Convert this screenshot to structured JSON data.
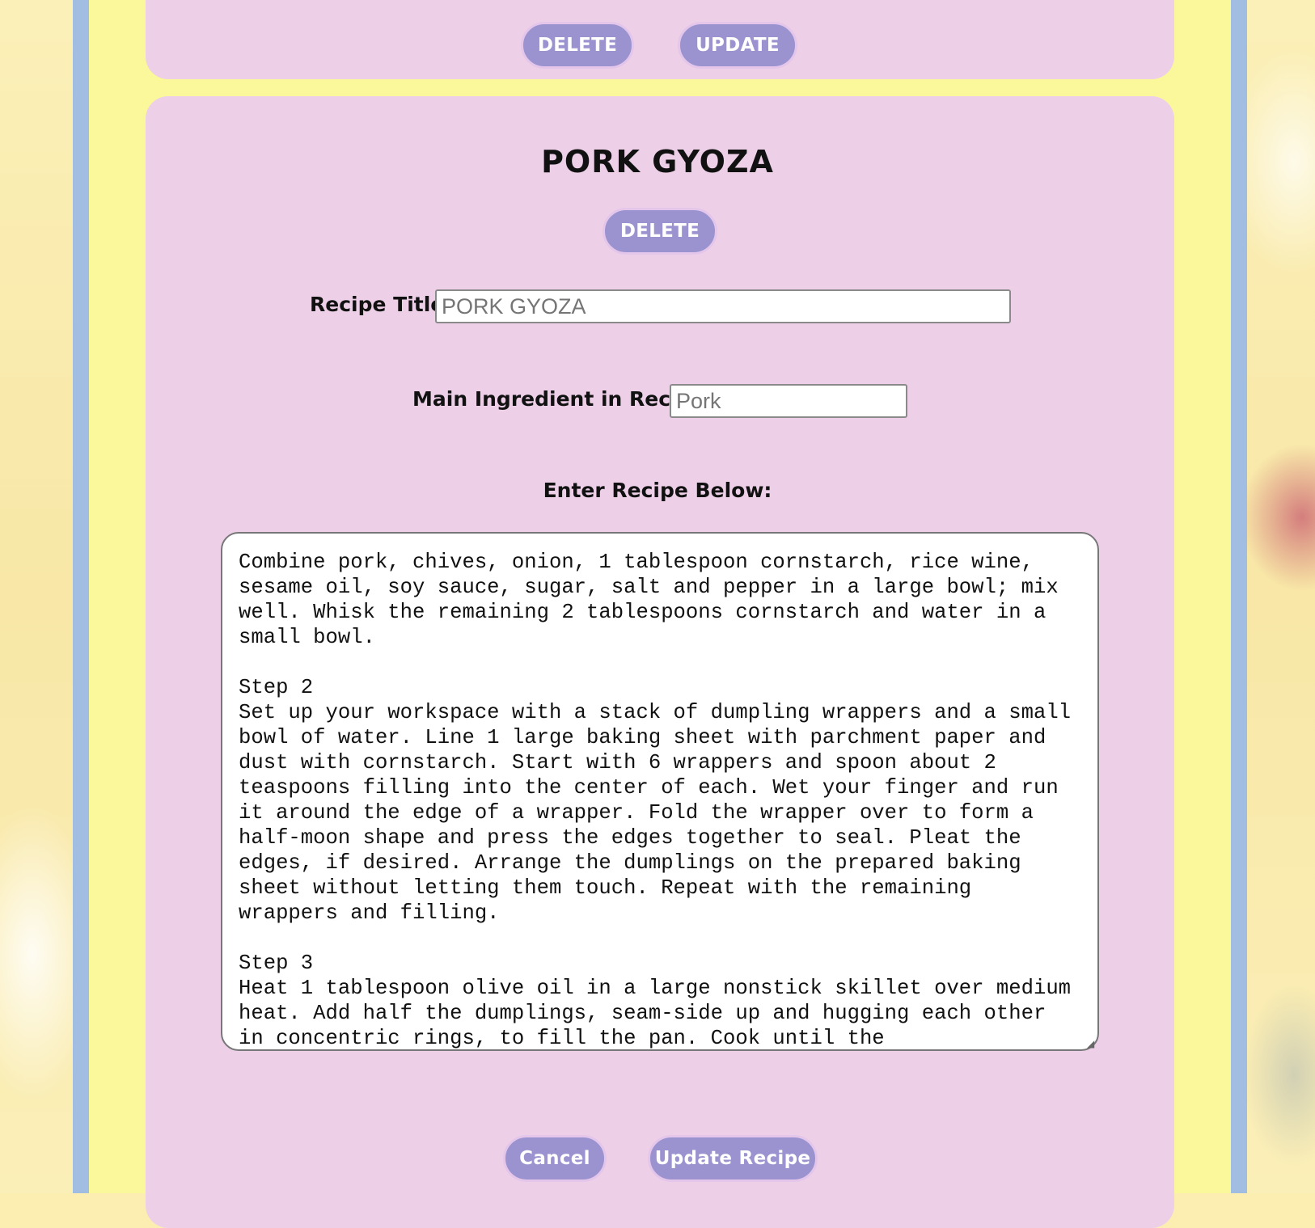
{
  "top_card": {
    "delete_label": "DELETE",
    "update_label": "UPDATE"
  },
  "recipe_card": {
    "title": "PORK GYOZA",
    "delete_label": "DELETE",
    "title_field": {
      "label": "Recipe Title:",
      "placeholder": "PORK GYOZA"
    },
    "ingredient_field": {
      "label": "Main Ingredient in Recipe:",
      "placeholder": "Pork"
    },
    "recipe_label": "Enter Recipe Below:",
    "recipe_text": "Combine pork, chives, onion, 1 tablespoon cornstarch, rice wine, sesame oil, soy sauce, sugar, salt and pepper in a large bowl; mix well. Whisk the remaining 2 tablespoons cornstarch and water in a small bowl.\n\nStep 2\nSet up your workspace with a stack of dumpling wrappers and a small bowl of water. Line 1 large baking sheet with parchment paper and dust with cornstarch. Start with 6 wrappers and spoon about 2 teaspoons filling into the center of each. Wet your finger and run it around the edge of a wrapper. Fold the wrapper over to form a half-moon shape and press the edges together to seal. Pleat the edges, if desired. Arrange the dumplings on the prepared baking sheet without letting them touch. Repeat with the remaining wrappers and filling.\n\nStep 3\nHeat 1 tablespoon olive oil in a large nonstick skillet over medium heat. Add half the dumplings, seam-side up and hugging each other in concentric rings, to fill the pan. Cook until the",
    "cancel_label": "Cancel",
    "update_recipe_label": "Update Recipe"
  },
  "colors": {
    "frame_blue": "#a2bde2",
    "frame_yellow": "#faf89a",
    "card_pink": "#edd0e8",
    "button_purple": "#9b93cf"
  }
}
